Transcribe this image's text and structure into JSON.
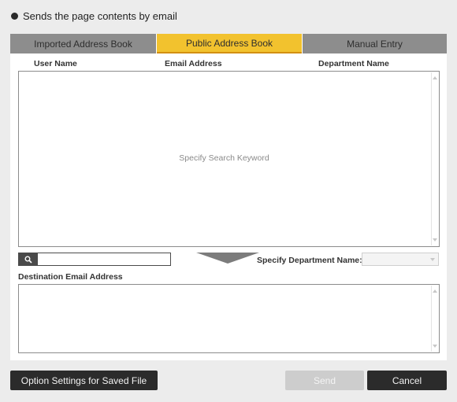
{
  "header": {
    "title": "Sends the page contents by email"
  },
  "tabs": [
    {
      "label": "Imported Address Book",
      "active": false
    },
    {
      "label": "Public Address Book",
      "active": true
    },
    {
      "label": "Manual Entry",
      "active": false
    }
  ],
  "columns": [
    "User Name",
    "Email Address",
    "Department Name"
  ],
  "list": {
    "placeholder": "Specify Search Keyword"
  },
  "search": {
    "value": "",
    "icon": "search-icon"
  },
  "department": {
    "label": "Specify Department Name:",
    "selected": ""
  },
  "destination": {
    "label": "Destination Email Address",
    "value": ""
  },
  "buttons": {
    "option": "Option Settings for Saved File",
    "send": "Send",
    "cancel": "Cancel"
  },
  "colors": {
    "active_tab": "#f2c22e",
    "inactive_tab": "#8d8d8d",
    "dark_button": "#2b2b2b",
    "disabled_button": "#cdcdcd"
  }
}
